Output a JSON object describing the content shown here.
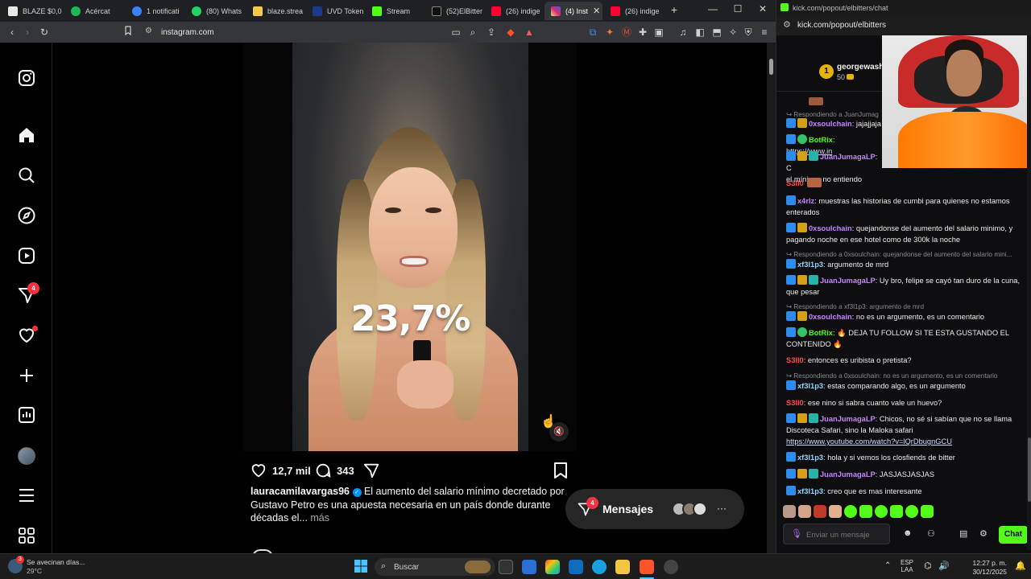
{
  "browser": {
    "tabs": [
      {
        "label": "BLAZE $0,0",
        "color": "#e8e8e8"
      },
      {
        "label": "Acércat",
        "color": "#1db954"
      },
      {
        "label": "1 notificati",
        "color": "#3b82f6"
      },
      {
        "label": "(80) Whats",
        "color": "#25d366"
      },
      {
        "label": "blaze.strea",
        "color": "#f2c94c"
      },
      {
        "label": "UVD Token",
        "color": "#1e3a8a"
      },
      {
        "label": "Stream",
        "color": "#53fc18"
      },
      {
        "label": "(52)ElBitter",
        "color": "#111111"
      },
      {
        "label": "(26) indige",
        "color": "#ff0033"
      },
      {
        "label": "(4) Inst",
        "color": "#e1306c"
      },
      {
        "label": "(26) indige",
        "color": "#ff0033"
      }
    ],
    "new_tab": "+",
    "window_controls": {
      "minimize": "—",
      "maximize": "☐",
      "close": "✕"
    },
    "url": "instagram.com",
    "extension_badge": "8"
  },
  "instagram": {
    "nav": [
      {
        "name": "instagram-logo-icon"
      },
      {
        "name": "home-icon"
      },
      {
        "name": "search-icon"
      },
      {
        "name": "explore-icon"
      },
      {
        "name": "reels-icon"
      },
      {
        "name": "messages-icon",
        "badge": "4"
      },
      {
        "name": "notifications-icon"
      },
      {
        "name": "create-icon"
      },
      {
        "name": "dashboard-icon"
      },
      {
        "name": "profile-avatar"
      },
      {
        "name": "more-menu-icon"
      },
      {
        "name": "also-from-meta-icon"
      }
    ],
    "video": {
      "overlay_text": "23,7%"
    },
    "likes": "12,7 mil",
    "comments": "343",
    "caption": {
      "username": "lauracamilavargas96",
      "text": " El aumento del salario mínimo decretado por Gustavo Petro es una apuesta necesaria en un país donde durante décadas el...",
      "more": " más"
    },
    "messages": {
      "label": "Mensajes",
      "badge": "4",
      "more": "···"
    }
  },
  "chat": {
    "window_title": "kick.com/popout/elbitters/chat",
    "url": "kick.com/popout/elbitters",
    "top_user": {
      "name": "georgewash",
      "rank": "1",
      "amount": "50"
    },
    "messages": [
      {
        "type": "reply",
        "text": "Respondiendo a JuanJumag"
      },
      {
        "type": "msg",
        "user": "0xsoulchain",
        "color": "u-purple",
        "text": ": jajajjaja"
      },
      {
        "type": "msg",
        "user": "BotRix",
        "color": "u-green",
        "text": ": ",
        "link": "https://www.in"
      },
      {
        "type": "msg",
        "user": "JuanJumagaLP",
        "color": "u-purple",
        "text": ": C",
        "cont": "el mínimo, no entiendo"
      },
      {
        "type": "msg",
        "user": "S3lI0",
        "color": "u-red",
        "text": ""
      },
      {
        "type": "msg",
        "user": "x4rlz",
        "color": "u-purple",
        "text": ": muestras las historias de cumbi para quienes no estamos enterados"
      },
      {
        "type": "msg",
        "user": "0xsoulchain",
        "color": "u-purple",
        "text": ": quejandonse del aumento del salario minimo, y pagando noche en ese hotel como de 300k la noche"
      },
      {
        "type": "reply",
        "text": "Respondiendo a 0xsoulchain: quejandonse del aumento del salario mini..."
      },
      {
        "type": "msg",
        "user": "xf3l1p3",
        "color": "u-cyan",
        "text": ": argumento de mrd"
      },
      {
        "type": "msg",
        "user": "JuanJumagaLP",
        "color": "u-purple",
        "text": ": Uy bro, felipe se cayó tan duro de la cuna, que pesar"
      },
      {
        "type": "reply",
        "text": "Respondiendo a xf3l1p3: argumento de mrd"
      },
      {
        "type": "msg",
        "user": "0xsoulchain",
        "color": "u-purple",
        "text": ": no es un argumento, es un comentario"
      },
      {
        "type": "msg",
        "user": "BotRix",
        "color": "u-green",
        "text": ": 🔥 DEJA TU FOLLOW SI TE ESTA GUSTANDO EL CONTENIDO 🔥"
      },
      {
        "type": "msg",
        "user": "S3lI0",
        "color": "u-red",
        "text": ": entonces es uribista o pretista?"
      },
      {
        "type": "reply",
        "text": "Respondiendo a 0xsoulchain: no es un argumento, es un comentario"
      },
      {
        "type": "msg",
        "user": "xf3l1p3",
        "color": "u-cyan",
        "text": ": estas comparando algo, es un argumento"
      },
      {
        "type": "msg",
        "user": "S3lI0",
        "color": "u-red",
        "text": ": ese nino si sabra cuanto vale un huevo?"
      },
      {
        "type": "msg",
        "user": "JuanJumagaLP",
        "color": "u-purple",
        "text": ": Chicos, no sé si sabían que no se llama Discoteca Safari, sino la Maloka safari",
        "link": "https://www.youtube.com/watch?v=lQrDbugnGCU"
      },
      {
        "type": "msg",
        "user": "xf3l1p3",
        "color": "u-cyan",
        "text": ": hola y si vemos los closfiends de bitter"
      },
      {
        "type": "msg",
        "user": "JuanJumagaLP",
        "color": "u-purple",
        "text": ": JASJASJASJAS"
      },
      {
        "type": "msg",
        "user": "xf3l1p3",
        "color": "u-cyan",
        "text": ": creo que es mas interesante"
      }
    ],
    "input_placeholder": "Enviar un mensaje",
    "send_label": "Chat"
  },
  "taskbar": {
    "weather_title": "Se avecinan días...",
    "weather_temp": "29°C",
    "weather_badge": "3",
    "search_placeholder": "Buscar",
    "lang_top": "ESP",
    "lang_bottom": "LAA",
    "time": "12:27 p. m.",
    "date": "30/12/2025"
  },
  "colors": {
    "kick_green": "#53fc18",
    "ig_red": "#ff3040",
    "ig_blue": "#0095f6"
  }
}
